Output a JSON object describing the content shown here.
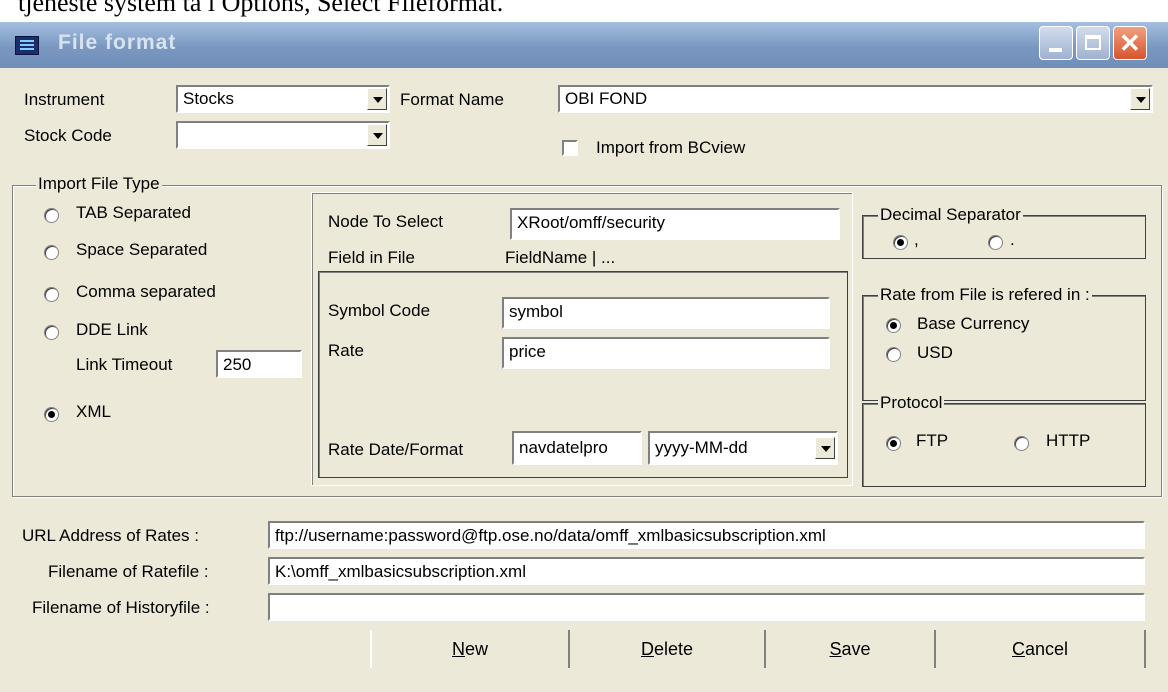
{
  "doc_text": "tjeneste system ta i Options, Select Fileformat.",
  "window": {
    "title": "File format"
  },
  "top": {
    "instrument_label": "Instrument",
    "instrument_value": "Stocks",
    "format_name_label": "Format Name",
    "format_name_value": "OBI FOND",
    "stock_code_label": "Stock Code",
    "stock_code_value": "",
    "import_bcview_label": "Import from BCview",
    "import_bcview_checked": false
  },
  "import_group": {
    "title": "Import File Type",
    "options": [
      {
        "label": "TAB Separated",
        "selected": false
      },
      {
        "label": "Space Separated",
        "selected": false
      },
      {
        "label": "Comma separated",
        "selected": false
      },
      {
        "label": "DDE Link",
        "selected": false
      },
      {
        "label": "XML",
        "selected": true
      }
    ],
    "link_timeout_label": "Link Timeout",
    "link_timeout_value": "250"
  },
  "xml": {
    "node_label": "Node To Select",
    "node_value": "XRoot/omff/security",
    "field_in_file_label": "Field in File",
    "field_in_file_value": "FieldName | ...",
    "symbol_label": "Symbol Code",
    "symbol_value": "symbol",
    "rate_label": "Rate",
    "rate_value": "price",
    "rate_date_label": "Rate Date/Format",
    "rate_date_value": "navdatelpro",
    "rate_format_value": "yyyy-MM-dd"
  },
  "decimal": {
    "title": "Decimal Separator",
    "options": [
      ",",
      "."
    ],
    "selected_index": 0
  },
  "rate_ref": {
    "title": "Rate from File is refered in :",
    "options": [
      "Base Currency",
      "USD"
    ],
    "selected_index": 0
  },
  "protocol": {
    "title": "Protocol",
    "options": [
      "FTP",
      "HTTP"
    ],
    "selected_index": 0
  },
  "bottom": {
    "url_label": "URL Address of Rates :",
    "url_value": "ftp://username:password@ftp.ose.no/data/omff_xmlbasicsubscription.xml",
    "ratefile_label": "Filename of Ratefile :",
    "ratefile_value": "K:\\omff_xmlbasicsubscription.xml",
    "historyfile_label": "Filename of Historyfile :",
    "historyfile_value": ""
  },
  "buttons": {
    "new_u": "N",
    "new_rest": "ew",
    "delete_u": "D",
    "delete_rest": "elete",
    "save_u": "S",
    "save_rest": "ave",
    "cancel_u": "C",
    "cancel_rest": "ancel"
  }
}
